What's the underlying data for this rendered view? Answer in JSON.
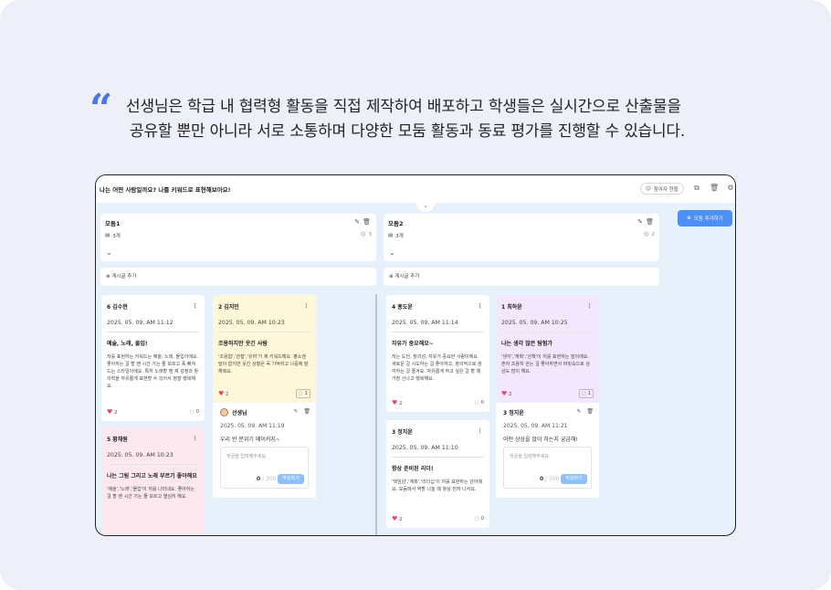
{
  "headline": {
    "line1": "선생님은 학급 내 협력형 활동을 직접 제작하여 배포하고 학생들은 실시간으로 산출물을",
    "line2": "공유할 뿐만 아니라 서로 소통하며 다양한 모둠 활동과 동료 평가를 진행할 수 있습니다."
  },
  "app": {
    "title": "나는 어떤 사람일까요? 나를 키워드로 표현해보아요!",
    "participants_label": "참여자 현황",
    "add_group_label": "모둠 추가하기",
    "add_post_label": "게시글 추가"
  },
  "groups": [
    {
      "name": "모둠1",
      "count": "3개",
      "members": "3"
    },
    {
      "name": "모둠2",
      "count": "3개",
      "members": "2"
    }
  ],
  "cards": [
    {
      "author": "6 김수현",
      "date": "2025. 05. 09. AM 11:12",
      "title": "예술, 노래, 몰입!",
      "body": "저를 표현하는 키워드는 예술, 노래, 몰입이에요. 좋아하는 걸 할 땐 시간 가는 줄 모르고 푹 빠져드는 스타일이에요. 특히 노래할 땐 제 감정과 창의력을 자유롭게 표현할 수 있어서 정말 행복해요.",
      "likes": "2",
      "comments": "0"
    },
    {
      "author": "2 김지민",
      "date": "2025. 05. 09. AM 10:23",
      "title": "조용하지만 웃긴 사람",
      "body": "'조용함','관찰','유머'가 제 키워드예요. 평소엔 말이 없지만 웃긴 상황은 꼭 기억하고 나중에 말해줘요.",
      "likes": "2",
      "comments": "1"
    },
    {
      "author": "4 홍도윤",
      "date": "2025. 05. 09. AM 11:14",
      "title": "자유가 중요해요~",
      "body": "저는 도전, 창의성, 자유가 중요한 사람이에요. 새로운 걸 시도하는 걸 좋아하고, 창의적으로 생각하는 걸 즐겨요. 자유롭게 하고 싶은 걸 할 때 가장 신나고 행복해요.",
      "likes": "2",
      "comments": "0"
    },
    {
      "author": "1 최하윤",
      "date": "2025. 05. 09. AM 10:25",
      "title": "나는 생각 많은 탐험가",
      "body": "'생각','계획','산책'이 저를 표현하는 말이에요. 혼자 조용히 걷는 걸 좋아하면서 머릿속으로 상상도 많이 해요.",
      "likes": "2",
      "comments": "1"
    },
    {
      "author": "5 황채원",
      "date": "2025. 05. 09. AM 10:23",
      "title": "나는 그림 그리고 노래 부르기 좋아해요",
      "body": "'예술','노래','몰입'이 저를 나타내요. 좋아하는 걸 할 땐 시간 가는 줄 모르고 열심히 해요.",
      "likes": "2",
      "comments": "0"
    },
    {
      "author": "3 정지윤",
      "date": "2025. 05. 09. AM 11:10",
      "title": "항상 준비된 리더!",
      "body": "'책임감','계획','리더십'이 저를 표현하는 단어예요. 모둠에서 역할 나눌 때 항상 먼저 나서요.",
      "likes": "2",
      "comments": "0"
    }
  ],
  "comments": [
    {
      "author": "선생님",
      "date": "2025. 05. 09. AM 11:19",
      "text": "우리 반 분위기 메이커지~",
      "placeholder": "댓글을 입력해주세요.",
      "count": "0",
      "max": "/ 300",
      "submit": "작성하기"
    },
    {
      "author": "3 정지윤",
      "date": "2025. 05. 09. AM 11:21",
      "text": "어떤 상상을 많이 하는지 궁금해!",
      "placeholder": "댓글을 입력해주세요.",
      "count": "0",
      "max": "/ 300",
      "submit": "작성하기"
    }
  ]
}
